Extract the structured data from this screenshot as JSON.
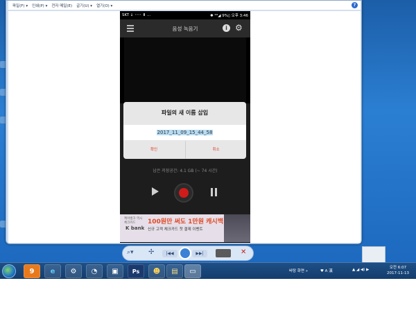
{
  "window": {
    "menu": [
      "파일(F) ▾",
      "인쇄(P) ▾",
      "전자 메일(E)",
      "굽기(U) ▾",
      "열기(O) ▾"
    ],
    "help_icon": "?"
  },
  "phone": {
    "status_left": "SKT ↓ ◦◦◦ ⬇ ...",
    "status_right": "✱ ⁴ᴳ◢ 9%▯ 오후 3:46",
    "app_title": "음성 녹음기",
    "storage_text": "남은 저장공간: 4.1 GB (~ 74 시간)",
    "icons": {
      "menu": "menu-icon",
      "info": "info-icon",
      "settings": "gear-icon",
      "play": "play-icon",
      "record": "record-icon",
      "pause": "pause-icon"
    }
  },
  "dialog": {
    "title": "파일의 새 이름 삽입",
    "filename": "2017_11_09_15_44_58",
    "ok": "확인",
    "cancel": "취소"
  },
  "ad": {
    "brand": "케이뱅크 역시\n체크카드",
    "bank": "K bank",
    "headline": "100원만 써도 1만원 캐시백",
    "sub": "신규 고객 체크카드 첫 결제 이벤트"
  },
  "player": {
    "zoom": "⌕▾",
    "pin": "✢",
    "prev": "|◀◀",
    "next": "▶▶|",
    "delete": "✕"
  },
  "taskbar": {
    "apps": [
      "9",
      "e",
      "⚙",
      "◔",
      "▣",
      "Ps",
      "☻",
      "▤",
      "▭"
    ],
    "tray_desktop": "바탕 화면 »",
    "tray_ime": "♥ A 漢",
    "tray_icons": "▲ ◢ ◀) ▶",
    "time": "오전 6:07",
    "date": "2017-11-13"
  },
  "colors": {
    "record_red": "#d01b1b",
    "dialog_btn": "#e03a2a",
    "taskbar": "#1e4f86"
  }
}
